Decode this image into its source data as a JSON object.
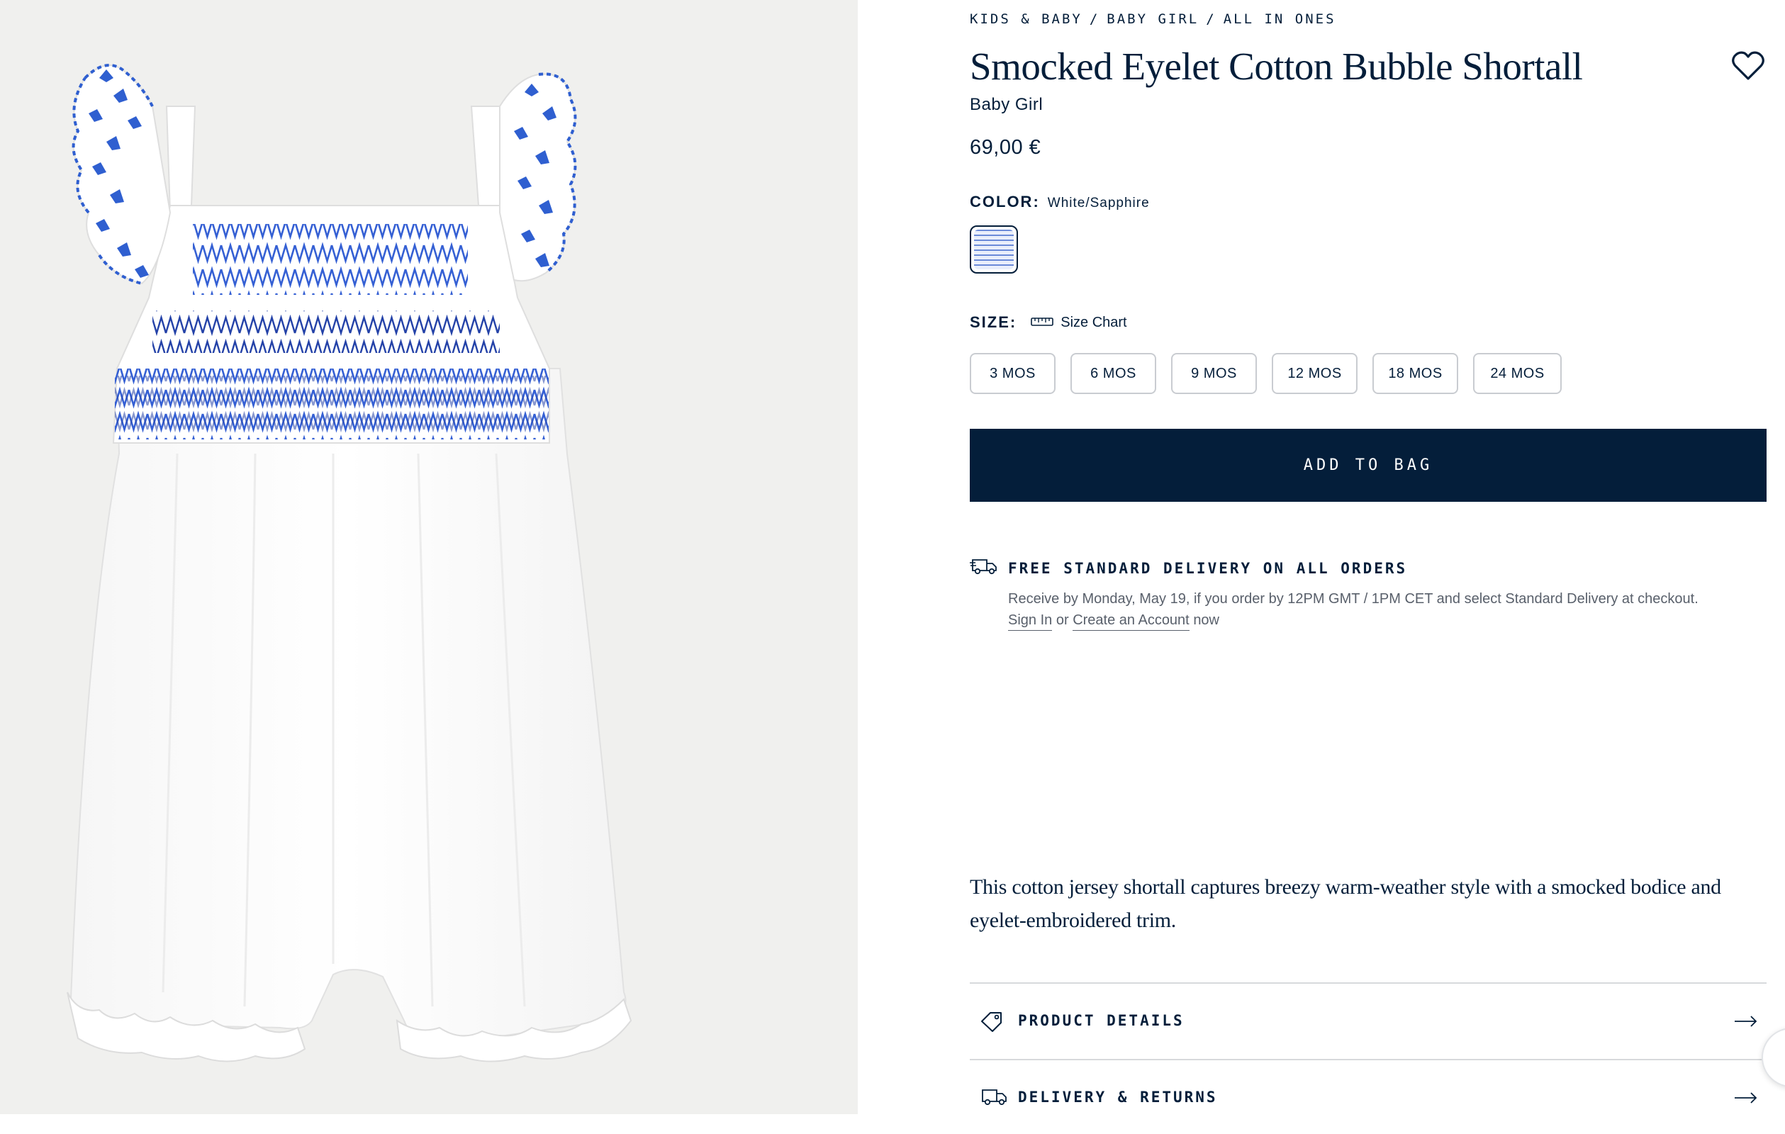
{
  "breadcrumb": {
    "items": [
      "KIDS & BABY",
      "BABY GIRL",
      "ALL IN ONES"
    ],
    "separator": "/"
  },
  "product": {
    "title": "Smocked Eyelet Cotton Bubble Shortall",
    "subtitle": "Baby Girl",
    "price": "69,00 €",
    "image_alt": "White smocked eyelet cotton bubble shortall with sapphire embroidery"
  },
  "color": {
    "label": "COLOR:",
    "value": "White/Sapphire"
  },
  "size": {
    "label": "SIZE:",
    "chart_label": "Size Chart",
    "options": [
      "3 MOS",
      "6 MOS",
      "9 MOS",
      "12 MOS",
      "18 MOS",
      "24 MOS"
    ]
  },
  "actions": {
    "add_to_bag": "ADD TO BAG"
  },
  "delivery": {
    "title": "FREE STANDARD DELIVERY ON ALL ORDERS",
    "text": "Receive by Monday, May 19, if you order by 12PM GMT / 1PM CET and select Standard Delivery at checkout.",
    "sign_in": "Sign In",
    "or": "or",
    "create_account": "Create an Account",
    "now": "now"
  },
  "description": "This cotton jersey shortall captures breezy warm-weather style with a smocked bodice and eyelet-embroidered trim.",
  "accordions": [
    {
      "label": "PRODUCT DETAILS",
      "icon": "tag-icon"
    },
    {
      "label": "DELIVERY & RETURNS",
      "icon": "delivery-truck-icon"
    }
  ],
  "colors": {
    "navy": "#041e3a",
    "sapphire": "#2f5fd0",
    "panel_bg": "#f0f0ee"
  }
}
